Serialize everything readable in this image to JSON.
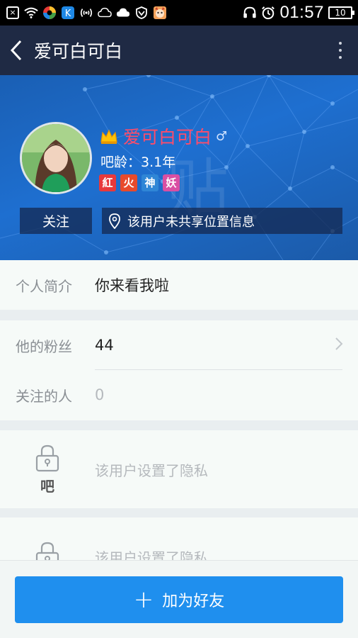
{
  "status_bar": {
    "time": "01:57",
    "battery": "10",
    "icons": [
      "close-box-icon",
      "wifi-icon",
      "color-app-icon",
      "k-app-icon",
      "nfc-icon",
      "weather-cloud-icon",
      "sun-cloud-icon",
      "shield-icon",
      "cat-app-icon",
      "headphones-icon",
      "alarm-icon"
    ]
  },
  "app_bar": {
    "title": "爱可白可白"
  },
  "profile": {
    "username": "爱可白可白",
    "gender_symbol": "♂",
    "age_text": "吧龄：3.1年",
    "badges": [
      {
        "text": "紅",
        "color": "#e8393b"
      },
      {
        "text": "火",
        "color": "#e84a2b"
      },
      {
        "text": "神",
        "color": "#2f86d6"
      },
      {
        "text": "妖",
        "color": "#d94fa3"
      }
    ],
    "follow_label": "关注",
    "location_text": "该用户未共享位置信息",
    "watermark": "贴"
  },
  "intro": {
    "label": "个人简介",
    "value": "你来看我啦"
  },
  "stats": {
    "fans_label": "他的粉丝",
    "fans_value": "44",
    "following_label": "关注的人",
    "following_value": "0"
  },
  "privacy_sections": [
    {
      "caption": "吧",
      "text": "该用户设置了隐私"
    },
    {
      "caption": "",
      "text": "该用户设置了隐私"
    }
  ],
  "bottom": {
    "add_friend_label": "加为好友",
    "plus_symbol": "+"
  },
  "colors": {
    "appbar": "#1f2a44",
    "banner": "#1e6fd0",
    "username": "#ff4c6a",
    "button": "#1f8fee"
  }
}
